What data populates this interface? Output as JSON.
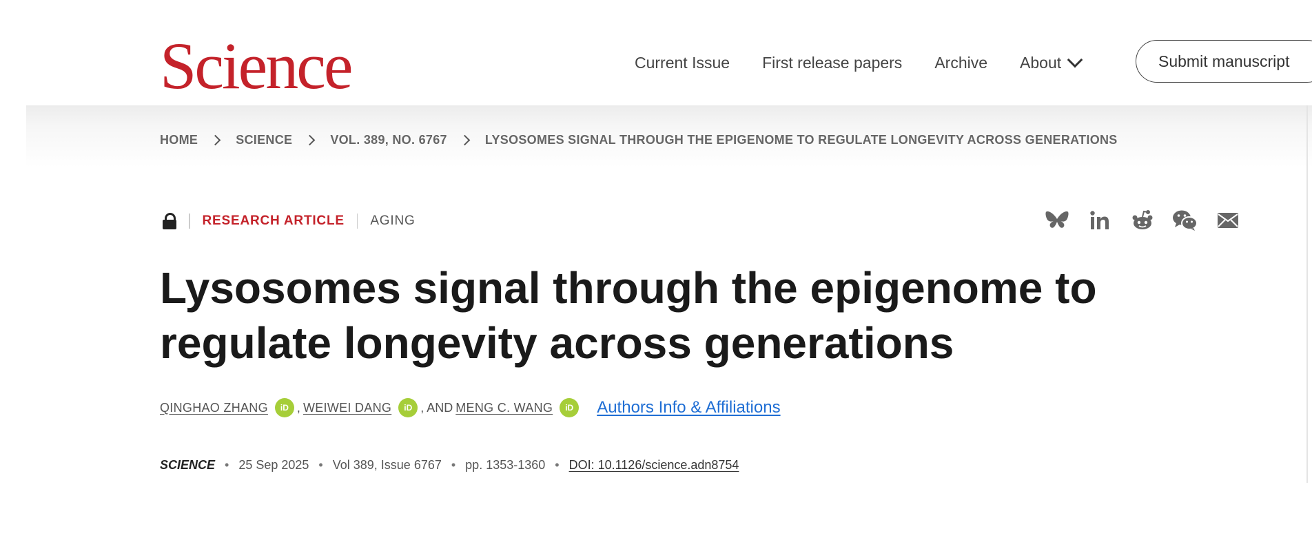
{
  "header": {
    "logo": "Science",
    "nav": [
      "Current Issue",
      "First release papers",
      "Archive",
      "About"
    ],
    "submit_label": "Submit manuscript"
  },
  "breadcrumb": [
    "HOME",
    "SCIENCE",
    "VOL. 389, NO. 6767",
    "LYSOSOMES SIGNAL THROUGH THE EPIGENOME TO REGULATE LONGEVITY ACROSS GENERATIONS"
  ],
  "article": {
    "access_icon": "lock-icon",
    "type": "RESEARCH ARTICLE",
    "subject": "AGING",
    "title": "Lysosomes signal through the epigenome to regulate longevity across generations",
    "authors": [
      "QINGHAO ZHANG",
      "WEIWEI DANG",
      "MENG C. WANG"
    ],
    "author_separators": [
      ",",
      ", AND"
    ],
    "orcid_label": "iD",
    "affiliations_link": "Authors Info & Affiliations"
  },
  "citation": {
    "journal": "SCIENCE",
    "date": "25 Sep 2025",
    "volume": "Vol 389, Issue 6767",
    "pages": "pp. 1353-1360",
    "doi": "DOI: 10.1126/science.adn8754",
    "separator": "•"
  },
  "share_icons": [
    "bluesky-icon",
    "linkedin-icon",
    "reddit-icon",
    "wechat-icon",
    "email-icon"
  ],
  "colors": {
    "brand_red": "#c4222a",
    "link_blue": "#1f6ed4",
    "orcid_green": "#a6ce39"
  }
}
